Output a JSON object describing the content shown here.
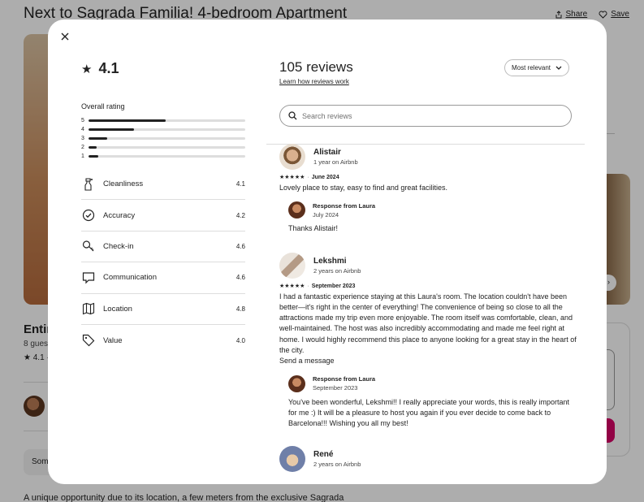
{
  "background": {
    "title": "Next to Sagrada Familia! 4-bedroom Apartment",
    "share_label": "Share",
    "save_label": "Save",
    "heading_fragment": "Entir",
    "guests_fragment": "8 gues",
    "rating_fragment": "★ 4.1 ·",
    "pill_fragment": "Som",
    "description_fragment": "A unique opportunity due to its location, a few meters from the exclusive Sagrada"
  },
  "modal": {
    "overall_rating": "4.1",
    "overall_title": "Overall rating",
    "distribution": [
      {
        "stars": "5",
        "fraction": 0.49
      },
      {
        "stars": "4",
        "fraction": 0.29
      },
      {
        "stars": "3",
        "fraction": 0.12
      },
      {
        "stars": "2",
        "fraction": 0.05
      },
      {
        "stars": "1",
        "fraction": 0.06
      }
    ],
    "categories": [
      {
        "label": "Cleanliness",
        "value": "4.1",
        "icon": "spray-bottle-icon"
      },
      {
        "label": "Accuracy",
        "value": "4.2",
        "icon": "check-circle-icon"
      },
      {
        "label": "Check-in",
        "value": "4.6",
        "icon": "key-icon"
      },
      {
        "label": "Communication",
        "value": "4.6",
        "icon": "chat-bubble-icon"
      },
      {
        "label": "Location",
        "value": "4.8",
        "icon": "map-icon"
      },
      {
        "label": "Value",
        "value": "4.0",
        "icon": "tag-icon"
      }
    ],
    "reviews_count": "105 reviews",
    "learn_link": "Learn how reviews work",
    "sort_label": "Most relevant",
    "search_placeholder": "Search reviews",
    "reviews": [
      {
        "name": "Alistair",
        "meta": "1 year on Airbnb",
        "stars": "★★★★★",
        "date": "June 2024",
        "text": "Lovely place to stay, easy to find and great facilities.",
        "response": {
          "title": "Response from Laura",
          "date": "July 2024",
          "text": "Thanks Alistair!"
        }
      },
      {
        "name": "Lekshmi",
        "meta": "2 years on Airbnb",
        "stars": "★★★★★",
        "date": "September 2023",
        "text": "I had a fantastic experience staying at this Laura's room. The location couldn't have been better—it's right in the center of everything! The convenience of being so close to all the attractions made my trip even more enjoyable. The room itself was comfortable, clean, and well-maintained. The host was also incredibly accommodating and made me feel right at home. I would highly recommend this place to anyone looking for a great stay in the heart of the city.",
        "extra": "Send a message",
        "response": {
          "title": "Response from Laura",
          "date": "September 2023",
          "text": "You've been wonderful, Lekshmi!! I really appreciate your words, this is really important for me :) It will be a pleasure to host you again if you ever decide to come back to Barcelona!!! Wishing you all my best!"
        }
      },
      {
        "name": "René",
        "meta": "2 years on Airbnb"
      }
    ]
  }
}
